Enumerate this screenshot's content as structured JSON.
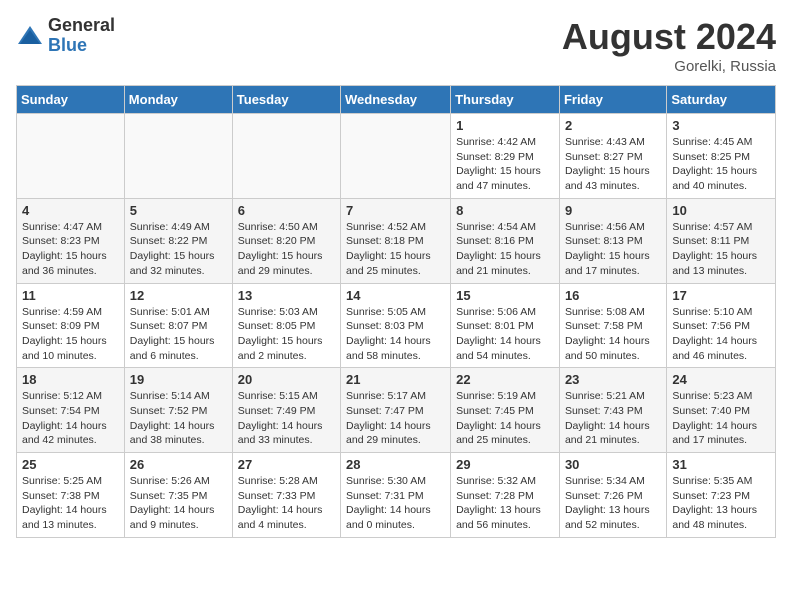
{
  "header": {
    "logo_general": "General",
    "logo_blue": "Blue",
    "month_year": "August 2024",
    "location": "Gorelki, Russia"
  },
  "weekdays": [
    "Sunday",
    "Monday",
    "Tuesday",
    "Wednesday",
    "Thursday",
    "Friday",
    "Saturday"
  ],
  "weeks": [
    [
      {
        "day": "",
        "info": ""
      },
      {
        "day": "",
        "info": ""
      },
      {
        "day": "",
        "info": ""
      },
      {
        "day": "",
        "info": ""
      },
      {
        "day": "1",
        "info": "Sunrise: 4:42 AM\nSunset: 8:29 PM\nDaylight: 15 hours\nand 47 minutes."
      },
      {
        "day": "2",
        "info": "Sunrise: 4:43 AM\nSunset: 8:27 PM\nDaylight: 15 hours\nand 43 minutes."
      },
      {
        "day": "3",
        "info": "Sunrise: 4:45 AM\nSunset: 8:25 PM\nDaylight: 15 hours\nand 40 minutes."
      }
    ],
    [
      {
        "day": "4",
        "info": "Sunrise: 4:47 AM\nSunset: 8:23 PM\nDaylight: 15 hours\nand 36 minutes."
      },
      {
        "day": "5",
        "info": "Sunrise: 4:49 AM\nSunset: 8:22 PM\nDaylight: 15 hours\nand 32 minutes."
      },
      {
        "day": "6",
        "info": "Sunrise: 4:50 AM\nSunset: 8:20 PM\nDaylight: 15 hours\nand 29 minutes."
      },
      {
        "day": "7",
        "info": "Sunrise: 4:52 AM\nSunset: 8:18 PM\nDaylight: 15 hours\nand 25 minutes."
      },
      {
        "day": "8",
        "info": "Sunrise: 4:54 AM\nSunset: 8:16 PM\nDaylight: 15 hours\nand 21 minutes."
      },
      {
        "day": "9",
        "info": "Sunrise: 4:56 AM\nSunset: 8:13 PM\nDaylight: 15 hours\nand 17 minutes."
      },
      {
        "day": "10",
        "info": "Sunrise: 4:57 AM\nSunset: 8:11 PM\nDaylight: 15 hours\nand 13 minutes."
      }
    ],
    [
      {
        "day": "11",
        "info": "Sunrise: 4:59 AM\nSunset: 8:09 PM\nDaylight: 15 hours\nand 10 minutes."
      },
      {
        "day": "12",
        "info": "Sunrise: 5:01 AM\nSunset: 8:07 PM\nDaylight: 15 hours\nand 6 minutes."
      },
      {
        "day": "13",
        "info": "Sunrise: 5:03 AM\nSunset: 8:05 PM\nDaylight: 15 hours\nand 2 minutes."
      },
      {
        "day": "14",
        "info": "Sunrise: 5:05 AM\nSunset: 8:03 PM\nDaylight: 14 hours\nand 58 minutes."
      },
      {
        "day": "15",
        "info": "Sunrise: 5:06 AM\nSunset: 8:01 PM\nDaylight: 14 hours\nand 54 minutes."
      },
      {
        "day": "16",
        "info": "Sunrise: 5:08 AM\nSunset: 7:58 PM\nDaylight: 14 hours\nand 50 minutes."
      },
      {
        "day": "17",
        "info": "Sunrise: 5:10 AM\nSunset: 7:56 PM\nDaylight: 14 hours\nand 46 minutes."
      }
    ],
    [
      {
        "day": "18",
        "info": "Sunrise: 5:12 AM\nSunset: 7:54 PM\nDaylight: 14 hours\nand 42 minutes."
      },
      {
        "day": "19",
        "info": "Sunrise: 5:14 AM\nSunset: 7:52 PM\nDaylight: 14 hours\nand 38 minutes."
      },
      {
        "day": "20",
        "info": "Sunrise: 5:15 AM\nSunset: 7:49 PM\nDaylight: 14 hours\nand 33 minutes."
      },
      {
        "day": "21",
        "info": "Sunrise: 5:17 AM\nSunset: 7:47 PM\nDaylight: 14 hours\nand 29 minutes."
      },
      {
        "day": "22",
        "info": "Sunrise: 5:19 AM\nSunset: 7:45 PM\nDaylight: 14 hours\nand 25 minutes."
      },
      {
        "day": "23",
        "info": "Sunrise: 5:21 AM\nSunset: 7:43 PM\nDaylight: 14 hours\nand 21 minutes."
      },
      {
        "day": "24",
        "info": "Sunrise: 5:23 AM\nSunset: 7:40 PM\nDaylight: 14 hours\nand 17 minutes."
      }
    ],
    [
      {
        "day": "25",
        "info": "Sunrise: 5:25 AM\nSunset: 7:38 PM\nDaylight: 14 hours\nand 13 minutes."
      },
      {
        "day": "26",
        "info": "Sunrise: 5:26 AM\nSunset: 7:35 PM\nDaylight: 14 hours\nand 9 minutes."
      },
      {
        "day": "27",
        "info": "Sunrise: 5:28 AM\nSunset: 7:33 PM\nDaylight: 14 hours\nand 4 minutes."
      },
      {
        "day": "28",
        "info": "Sunrise: 5:30 AM\nSunset: 7:31 PM\nDaylight: 14 hours\nand 0 minutes."
      },
      {
        "day": "29",
        "info": "Sunrise: 5:32 AM\nSunset: 7:28 PM\nDaylight: 13 hours\nand 56 minutes."
      },
      {
        "day": "30",
        "info": "Sunrise: 5:34 AM\nSunset: 7:26 PM\nDaylight: 13 hours\nand 52 minutes."
      },
      {
        "day": "31",
        "info": "Sunrise: 5:35 AM\nSunset: 7:23 PM\nDaylight: 13 hours\nand 48 minutes."
      }
    ]
  ]
}
